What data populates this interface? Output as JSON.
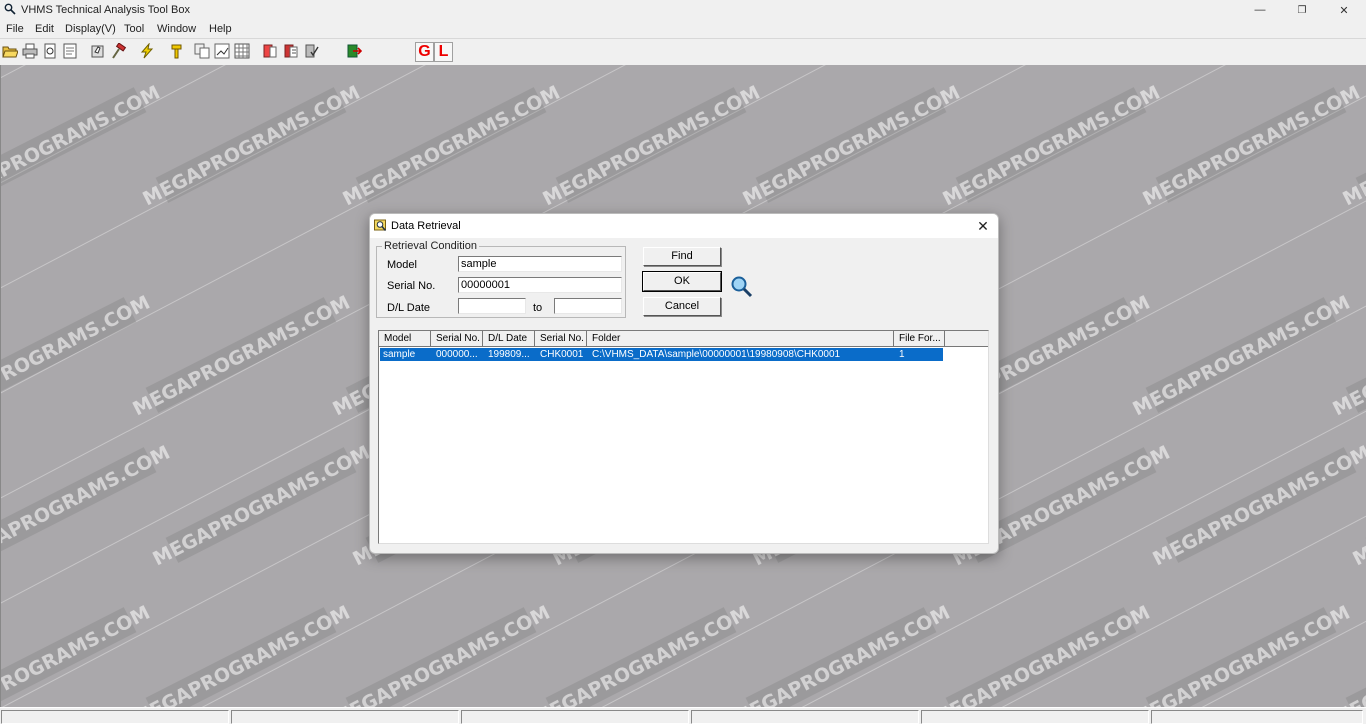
{
  "app": {
    "title": "VHMS Technical Analysis Tool Box",
    "window_buttons": {
      "minimize": "—",
      "restore": "❐",
      "close": "✕"
    }
  },
  "menu": [
    "File",
    "Edit",
    "Display(V)",
    "Tool",
    "Window",
    "Help"
  ],
  "toolbar": {
    "buttons": [
      "open-icon",
      "print-icon",
      "print-preview-icon",
      "report-icon",
      "hand-tool-icon",
      "hammer-icon",
      "lightning-icon",
      "hammer-yellow-icon",
      "copy-icon",
      "chart-icon",
      "grid-icon",
      "book-icon",
      "book-list-icon",
      "book-check-icon",
      "exit-icon"
    ],
    "g_label": "G",
    "l_label": "L"
  },
  "watermark_text": "MEGAPROGRAMS.COM",
  "dialog": {
    "title": "Data Retrieval",
    "close_label": "✕",
    "group_label": "Retrieval Condition",
    "fields": {
      "model_label": "Model",
      "model_value": "sample",
      "serial_label": "Serial No.",
      "serial_value": "00000001",
      "date_label": "D/L Date",
      "date_from_value": "",
      "to_label": "to",
      "date_to_value": ""
    },
    "buttons": {
      "find": "Find",
      "ok": "OK",
      "cancel": "Cancel"
    },
    "list": {
      "columns": [
        "Model",
        "Serial No.",
        "D/L Date",
        "Serial No.",
        "Folder",
        "File For..."
      ],
      "rows": [
        [
          "sample",
          "000000...",
          "199809...",
          "CHK0001",
          "C:\\VHMS_DATA\\sample\\00000001\\19980908\\CHK0001",
          "1"
        ]
      ]
    }
  },
  "colors": {
    "workspace": "#aaa8ab",
    "selection": "#0a6cc9",
    "gl_red": "#ee0000"
  }
}
